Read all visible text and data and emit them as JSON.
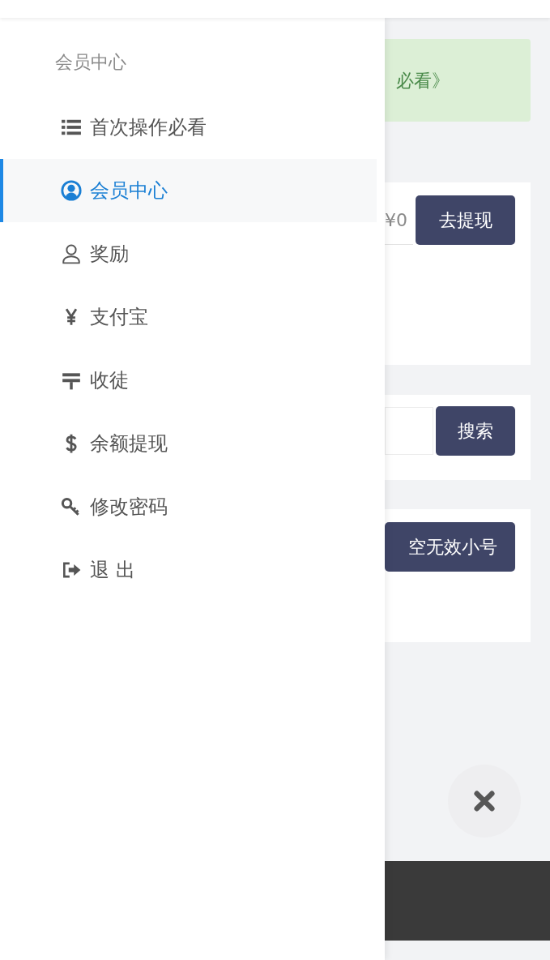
{
  "sidebar": {
    "title": "会员中心",
    "items": [
      {
        "label": "首次操作必看",
        "selected": false
      },
      {
        "label": "会员中心",
        "selected": true
      },
      {
        "label": "奖励",
        "selected": false
      },
      {
        "label": "支付宝",
        "selected": false
      },
      {
        "label": "收徒",
        "selected": false
      },
      {
        "label": "余额提现",
        "selected": false
      },
      {
        "label": "修改密码",
        "selected": false
      },
      {
        "label": "退 出",
        "selected": false
      }
    ]
  },
  "page": {
    "notice": "必看》",
    "balance": {
      "value": "¥0",
      "button": "去提现"
    },
    "search": {
      "button": "搜索"
    },
    "clear_button": "空无效小号"
  }
}
